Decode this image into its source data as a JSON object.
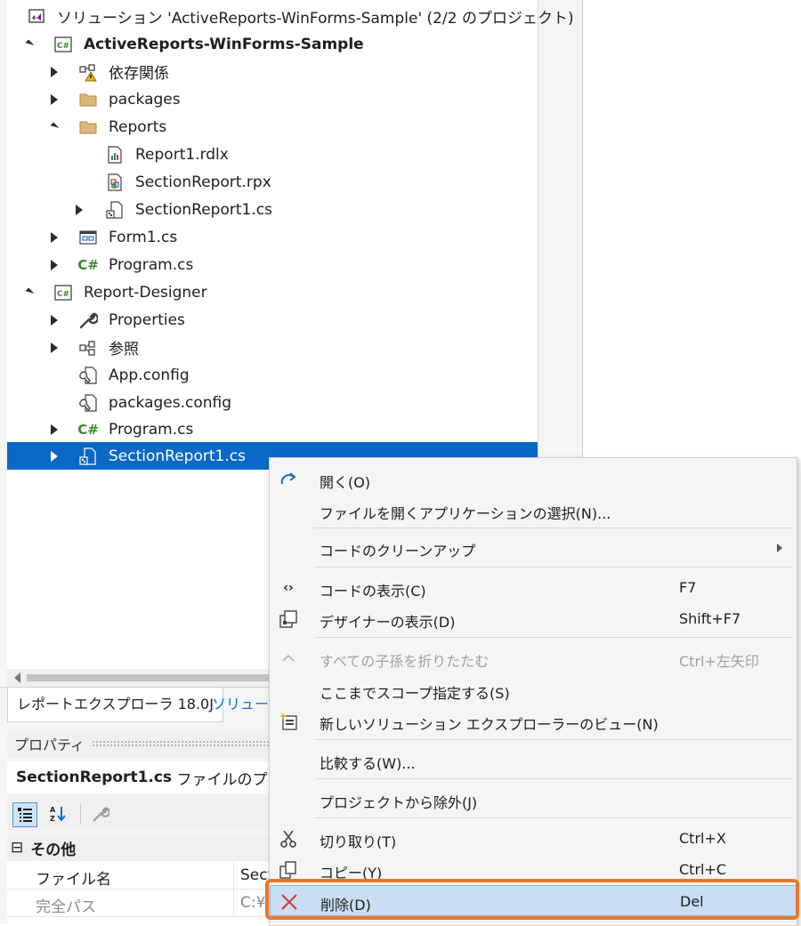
{
  "solution_explorer": {
    "solution_title": "ソリューション 'ActiveReports-WinForms-Sample' (2/2 のプロジェクト)",
    "nodes": [
      {
        "label": "ActiveReports-WinForms-Sample",
        "icon": "csharp-project-icon",
        "expander": "expanded",
        "bold": true
      },
      {
        "label": "依存関係",
        "icon": "dependencies-warning-icon",
        "expander": "collapsed"
      },
      {
        "label": "packages",
        "icon": "folder-icon",
        "expander": "collapsed"
      },
      {
        "label": "Reports",
        "icon": "folder-icon",
        "expander": "expanded"
      },
      {
        "label": "Report1.rdlx",
        "icon": "rdlx-report-icon",
        "expander": "none"
      },
      {
        "label": "SectionReport.rpx",
        "icon": "rpx-report-icon",
        "expander": "none"
      },
      {
        "label": "SectionReport1.cs",
        "icon": "cs-file-icon",
        "expander": "collapsed"
      },
      {
        "label": "Form1.cs",
        "icon": "form-icon",
        "expander": "collapsed"
      },
      {
        "label": "Program.cs",
        "icon": "csharp-file-icon",
        "expander": "collapsed"
      },
      {
        "label": "Report-Designer",
        "icon": "csharp-project-icon",
        "expander": "expanded"
      },
      {
        "label": "Properties",
        "icon": "wrench-icon",
        "expander": "collapsed"
      },
      {
        "label": "参照",
        "icon": "references-icon",
        "expander": "collapsed"
      },
      {
        "label": "App.config",
        "icon": "config-file-icon",
        "expander": "none"
      },
      {
        "label": "packages.config",
        "icon": "config-file-icon",
        "expander": "none"
      },
      {
        "label": "Program.cs",
        "icon": "csharp-file-icon",
        "expander": "collapsed"
      },
      {
        "label": "SectionReport1.cs",
        "icon": "cs-file-icon",
        "expander": "collapsed",
        "selected": true
      }
    ],
    "csharp_glyph": "C#"
  },
  "tabs": {
    "report_explorer": "レポートエクスプローラ 18.0J",
    "solution_explorer": "ソリューシ"
  },
  "properties": {
    "title": "プロパティ",
    "object_bold": "SectionReport1.cs",
    "object_rest": " ファイルのプロパテ",
    "category": "その他",
    "category_toggle": "⊟",
    "rows": [
      {
        "name": "ファイル名",
        "value": "Sect"
      },
      {
        "name": "完全パス",
        "value": "C:¥"
      }
    ]
  },
  "context_menu": {
    "items": [
      {
        "label": "開く(O)",
        "shortcut": "",
        "icon": "open-arrow-icon"
      },
      {
        "label": "ファイルを開くアプリケーションの選択(N)...",
        "shortcut": "",
        "icon": ""
      },
      {
        "label": "コードのクリーンアップ",
        "shortcut": "",
        "icon": "",
        "submenu": true
      },
      {
        "label": "コードの表示(C)",
        "shortcut": "F7",
        "icon": "view-code-icon"
      },
      {
        "label": "デザイナーの表示(D)",
        "shortcut": "Shift+F7",
        "icon": "view-designer-icon"
      },
      {
        "label": "すべての子孫を折りたたむ",
        "shortcut": "Ctrl+左矢印",
        "icon": "collapse-icon",
        "disabled": true
      },
      {
        "label": "ここまでスコープ指定する(S)",
        "shortcut": "",
        "icon": ""
      },
      {
        "label": "新しいソリューション エクスプローラーのビュー(N)",
        "shortcut": "",
        "icon": "new-view-icon"
      },
      {
        "label": "比較する(W)...",
        "shortcut": "",
        "icon": ""
      },
      {
        "label": "プロジェクトから除外(J)",
        "shortcut": "",
        "icon": ""
      },
      {
        "label": "切り取り(T)",
        "shortcut": "Ctrl+X",
        "icon": "scissors-icon"
      },
      {
        "label": "コピー(Y)",
        "shortcut": "Ctrl+C",
        "icon": "copy-icon"
      },
      {
        "label": "削除(D)",
        "shortcut": "Del",
        "icon": "delete-x-icon",
        "highlighted": true
      }
    ]
  },
  "colors": {
    "selection": "#0a69c7",
    "highlight_outline": "#e8782a",
    "menu_hover": "#c9def5",
    "csharp_green": "#3c8a2e",
    "vs_purple": "#68217a",
    "folder": "#dcb67a"
  }
}
